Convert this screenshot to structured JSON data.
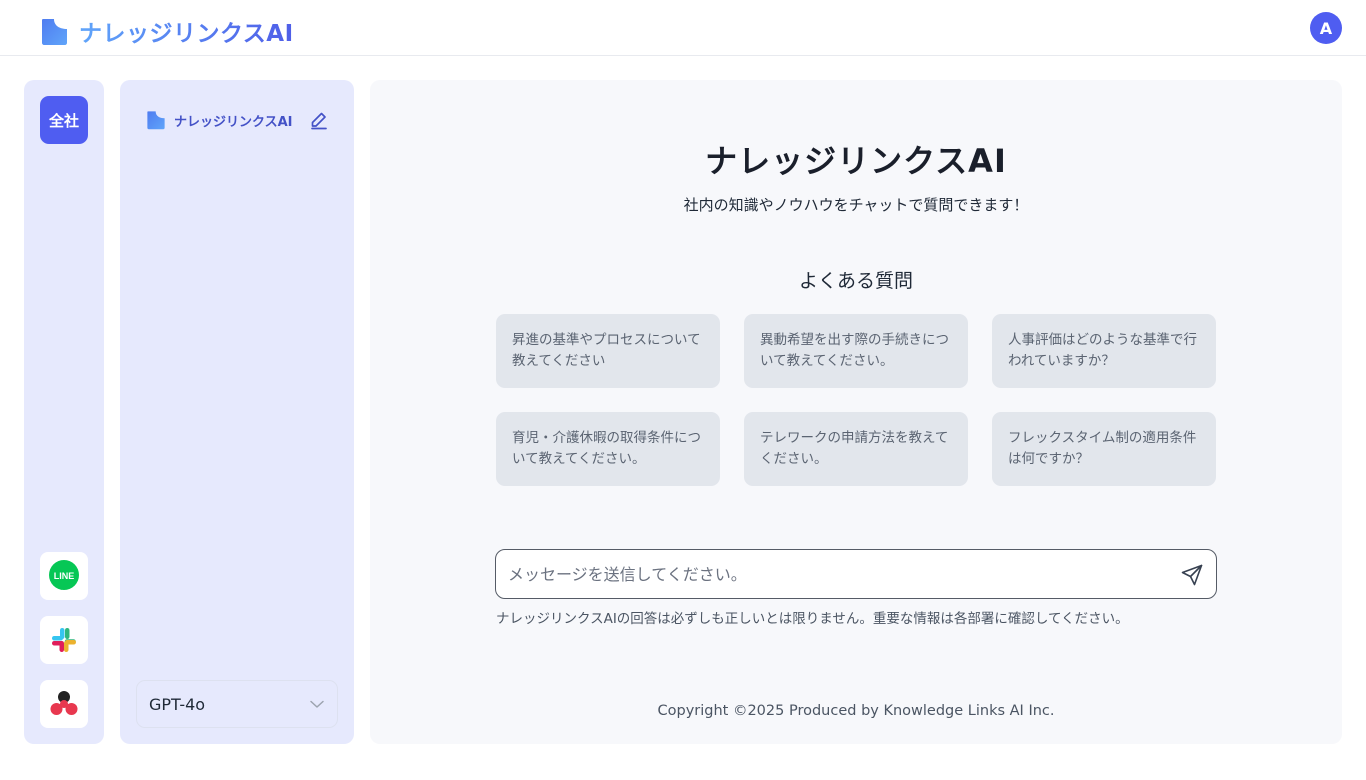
{
  "header": {
    "brand_name": "ナレッジリンクスAI",
    "avatar_initial": "A"
  },
  "rail": {
    "company_label": "全社",
    "apps": [
      {
        "name": "LINE",
        "icon": "line-icon",
        "label": "LINE"
      },
      {
        "name": "Slack",
        "icon": "slack-icon"
      },
      {
        "name": "Asana",
        "icon": "asana-icon"
      }
    ]
  },
  "panel": {
    "title": "ナレッジリンクスAI",
    "model_selected": "GPT-4o"
  },
  "main": {
    "title": "ナレッジリンクスAI",
    "subtitle": "社内の知識やノウハウをチャットで質問できます！",
    "faq_title": "よくある質問",
    "faq": [
      "昇進の基準やプロセスについて教えてください",
      "異動希望を出す際の手続きについて教えてください。",
      "人事評価はどのような基準で行われていますか？",
      "育児・介護休暇の取得条件について教えてください。",
      "テレワークの申請方法を教えてください。",
      "フレックスタイム制の適用条件は何ですか？"
    ],
    "input_placeholder": "メッセージを送信してください。",
    "disclaimer": "ナレッジリンクスAIの回答は必ずしも正しいとは限りません。重要な情報は各部署に確認してください。",
    "copyright": "Copyright ©2025 Produced by Knowledge Links AI Inc."
  },
  "colors": {
    "accent": "#4f5df1",
    "panel_bg": "#e6e9fd",
    "card_bg": "#e2e6ec",
    "main_bg": "#f7f8fb"
  }
}
